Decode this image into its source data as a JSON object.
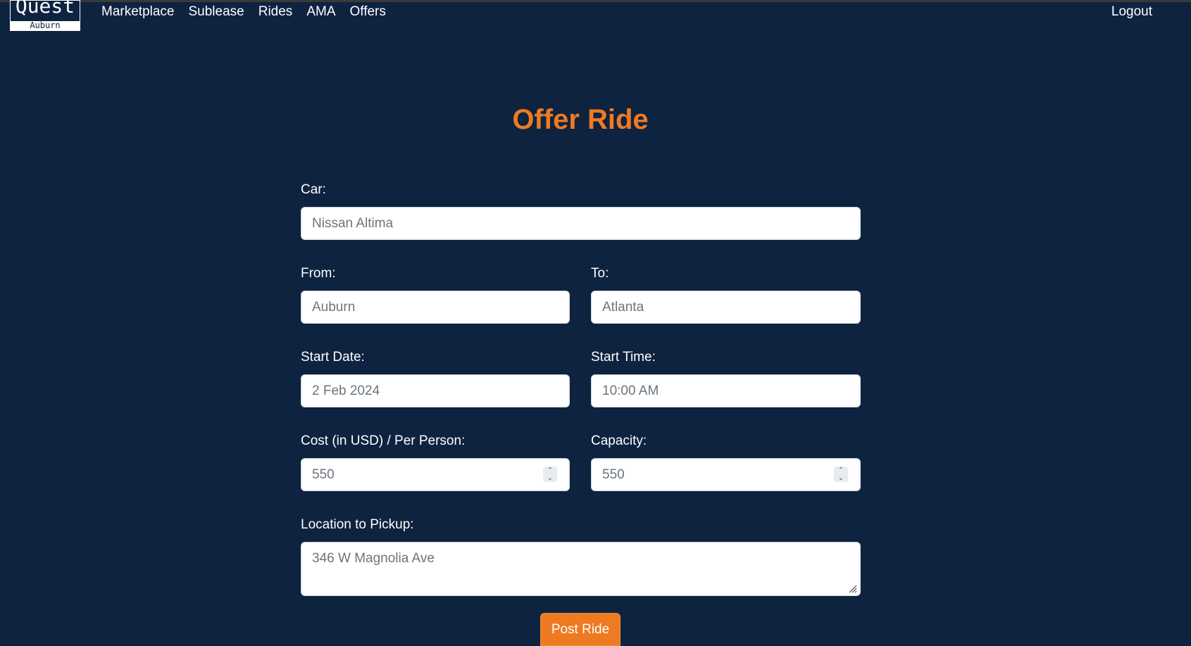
{
  "nav": {
    "logo": {
      "main": "Quest",
      "sub": "Auburn"
    },
    "links": [
      "Marketplace",
      "Sublease",
      "Rides",
      "AMA",
      "Offers"
    ],
    "logout": "Logout"
  },
  "page": {
    "title": "Offer Ride"
  },
  "form": {
    "car": {
      "label": "Car:",
      "placeholder": "Nissan Altima"
    },
    "from": {
      "label": "From:",
      "placeholder": "Auburn"
    },
    "to": {
      "label": "To:",
      "placeholder": "Atlanta"
    },
    "start_date": {
      "label": "Start Date:",
      "placeholder": "2 Feb 2024"
    },
    "start_time": {
      "label": "Start Time:",
      "placeholder": "10:00 AM"
    },
    "cost": {
      "label": "Cost (in USD) / Per Person:",
      "placeholder": "550"
    },
    "capacity": {
      "label": "Capacity:",
      "placeholder": "550"
    },
    "pickup": {
      "label": "Location to Pickup:",
      "placeholder": "346 W Magnolia Ave"
    },
    "submit_label": "Post Ride"
  },
  "colors": {
    "background": "#0d2340",
    "accent": "#ee7a22"
  }
}
